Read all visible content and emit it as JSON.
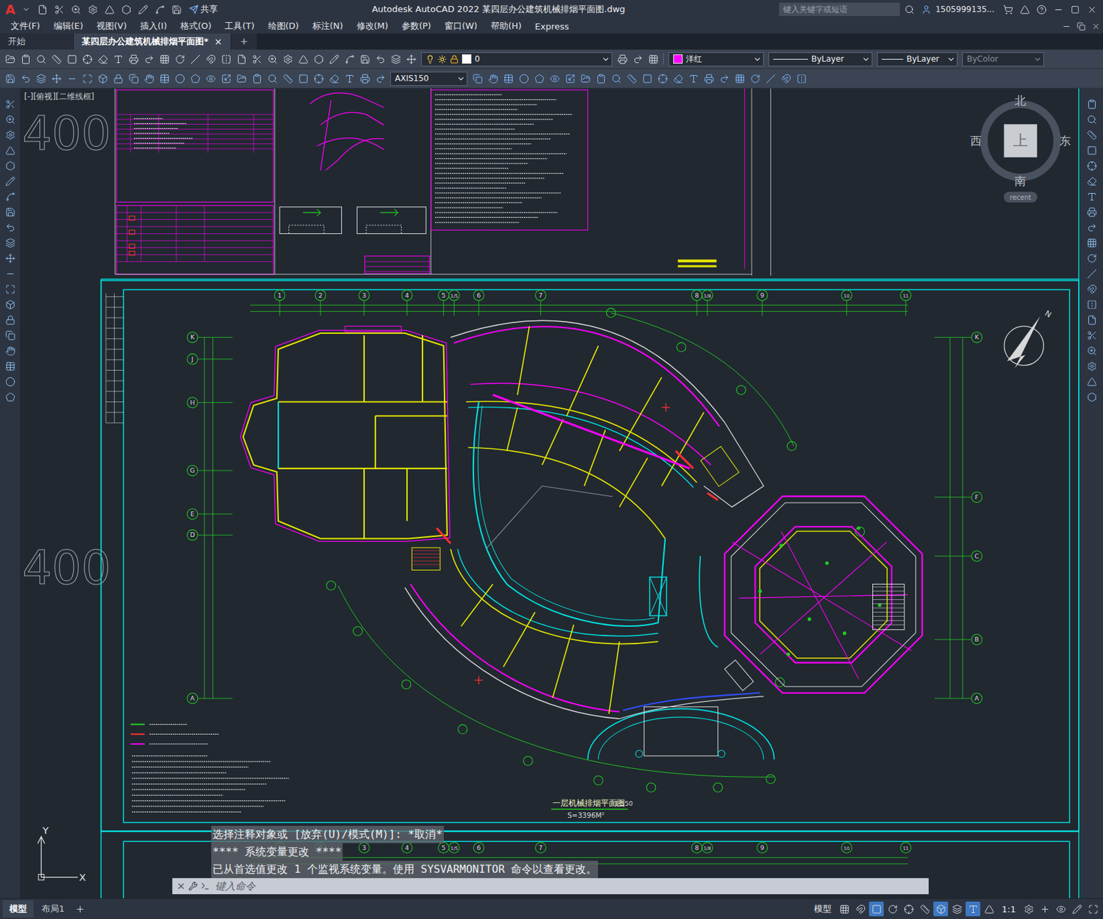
{
  "window": {
    "app_icon": "A",
    "share": "共享",
    "title": "Autodesk AutoCAD 2022    某四层办公建筑机械排烟平面图.dwg",
    "search_placeholder": "键入关键字或短语",
    "user": "1505999135..."
  },
  "menu": [
    "文件(F)",
    "编辑(E)",
    "视图(V)",
    "插入(I)",
    "格式(O)",
    "工具(T)",
    "绘图(D)",
    "标注(N)",
    "修改(M)",
    "参数(P)",
    "窗口(W)",
    "帮助(H)",
    "Express"
  ],
  "doc_tabs": [
    {
      "label": "开始",
      "selected": false
    },
    {
      "label": "某四层办公建筑机械排烟平面图*",
      "selected": true
    }
  ],
  "properties": {
    "layer": "0",
    "color_name": "洋红",
    "color": "#ff00ff",
    "linetype": "ByLayer",
    "lineweight": "ByLayer",
    "plotstyle": "ByColor",
    "plotstyle_disabled": true,
    "dimstyle": "AXIS150"
  },
  "viewport_label": "[-][俯视][二维线框]",
  "viewcube": {
    "north": "北",
    "south": "南",
    "east": "东",
    "west": "西",
    "face": "上",
    "recent": "recent"
  },
  "background_text": [
    "400",
    "400"
  ],
  "drawing": {
    "top_axes": [
      "1",
      "2",
      "3",
      "4",
      "5",
      "1/5",
      "6",
      "7",
      "8",
      "1/8",
      "9",
      "10",
      "11"
    ],
    "left_axes": [
      "K",
      "J",
      "H",
      "G",
      "E",
      "D",
      "A"
    ],
    "right_axes": [
      "K",
      "F",
      "C",
      "B",
      "A"
    ],
    "north": "N",
    "title": "一层机械排烟平面图",
    "scale": "1:150",
    "area": "S=3396M²"
  },
  "ucs": {
    "x": "X",
    "y": "Y"
  },
  "command_history": [
    "选择注释对象或 [放弃(U)/模式(M)]: *取消*",
    "**** 系统变量更改 ****",
    "已从首选值更改 1 个监视系统变量。使用 SYSVARMONITOR 命令以查看更改。"
  ],
  "command_placeholder": "键入命令",
  "layout_tabs": [
    {
      "label": "模型",
      "selected": true
    },
    {
      "label": "布局1",
      "selected": false
    }
  ],
  "status": {
    "space": "模型",
    "scale": "1:1"
  }
}
